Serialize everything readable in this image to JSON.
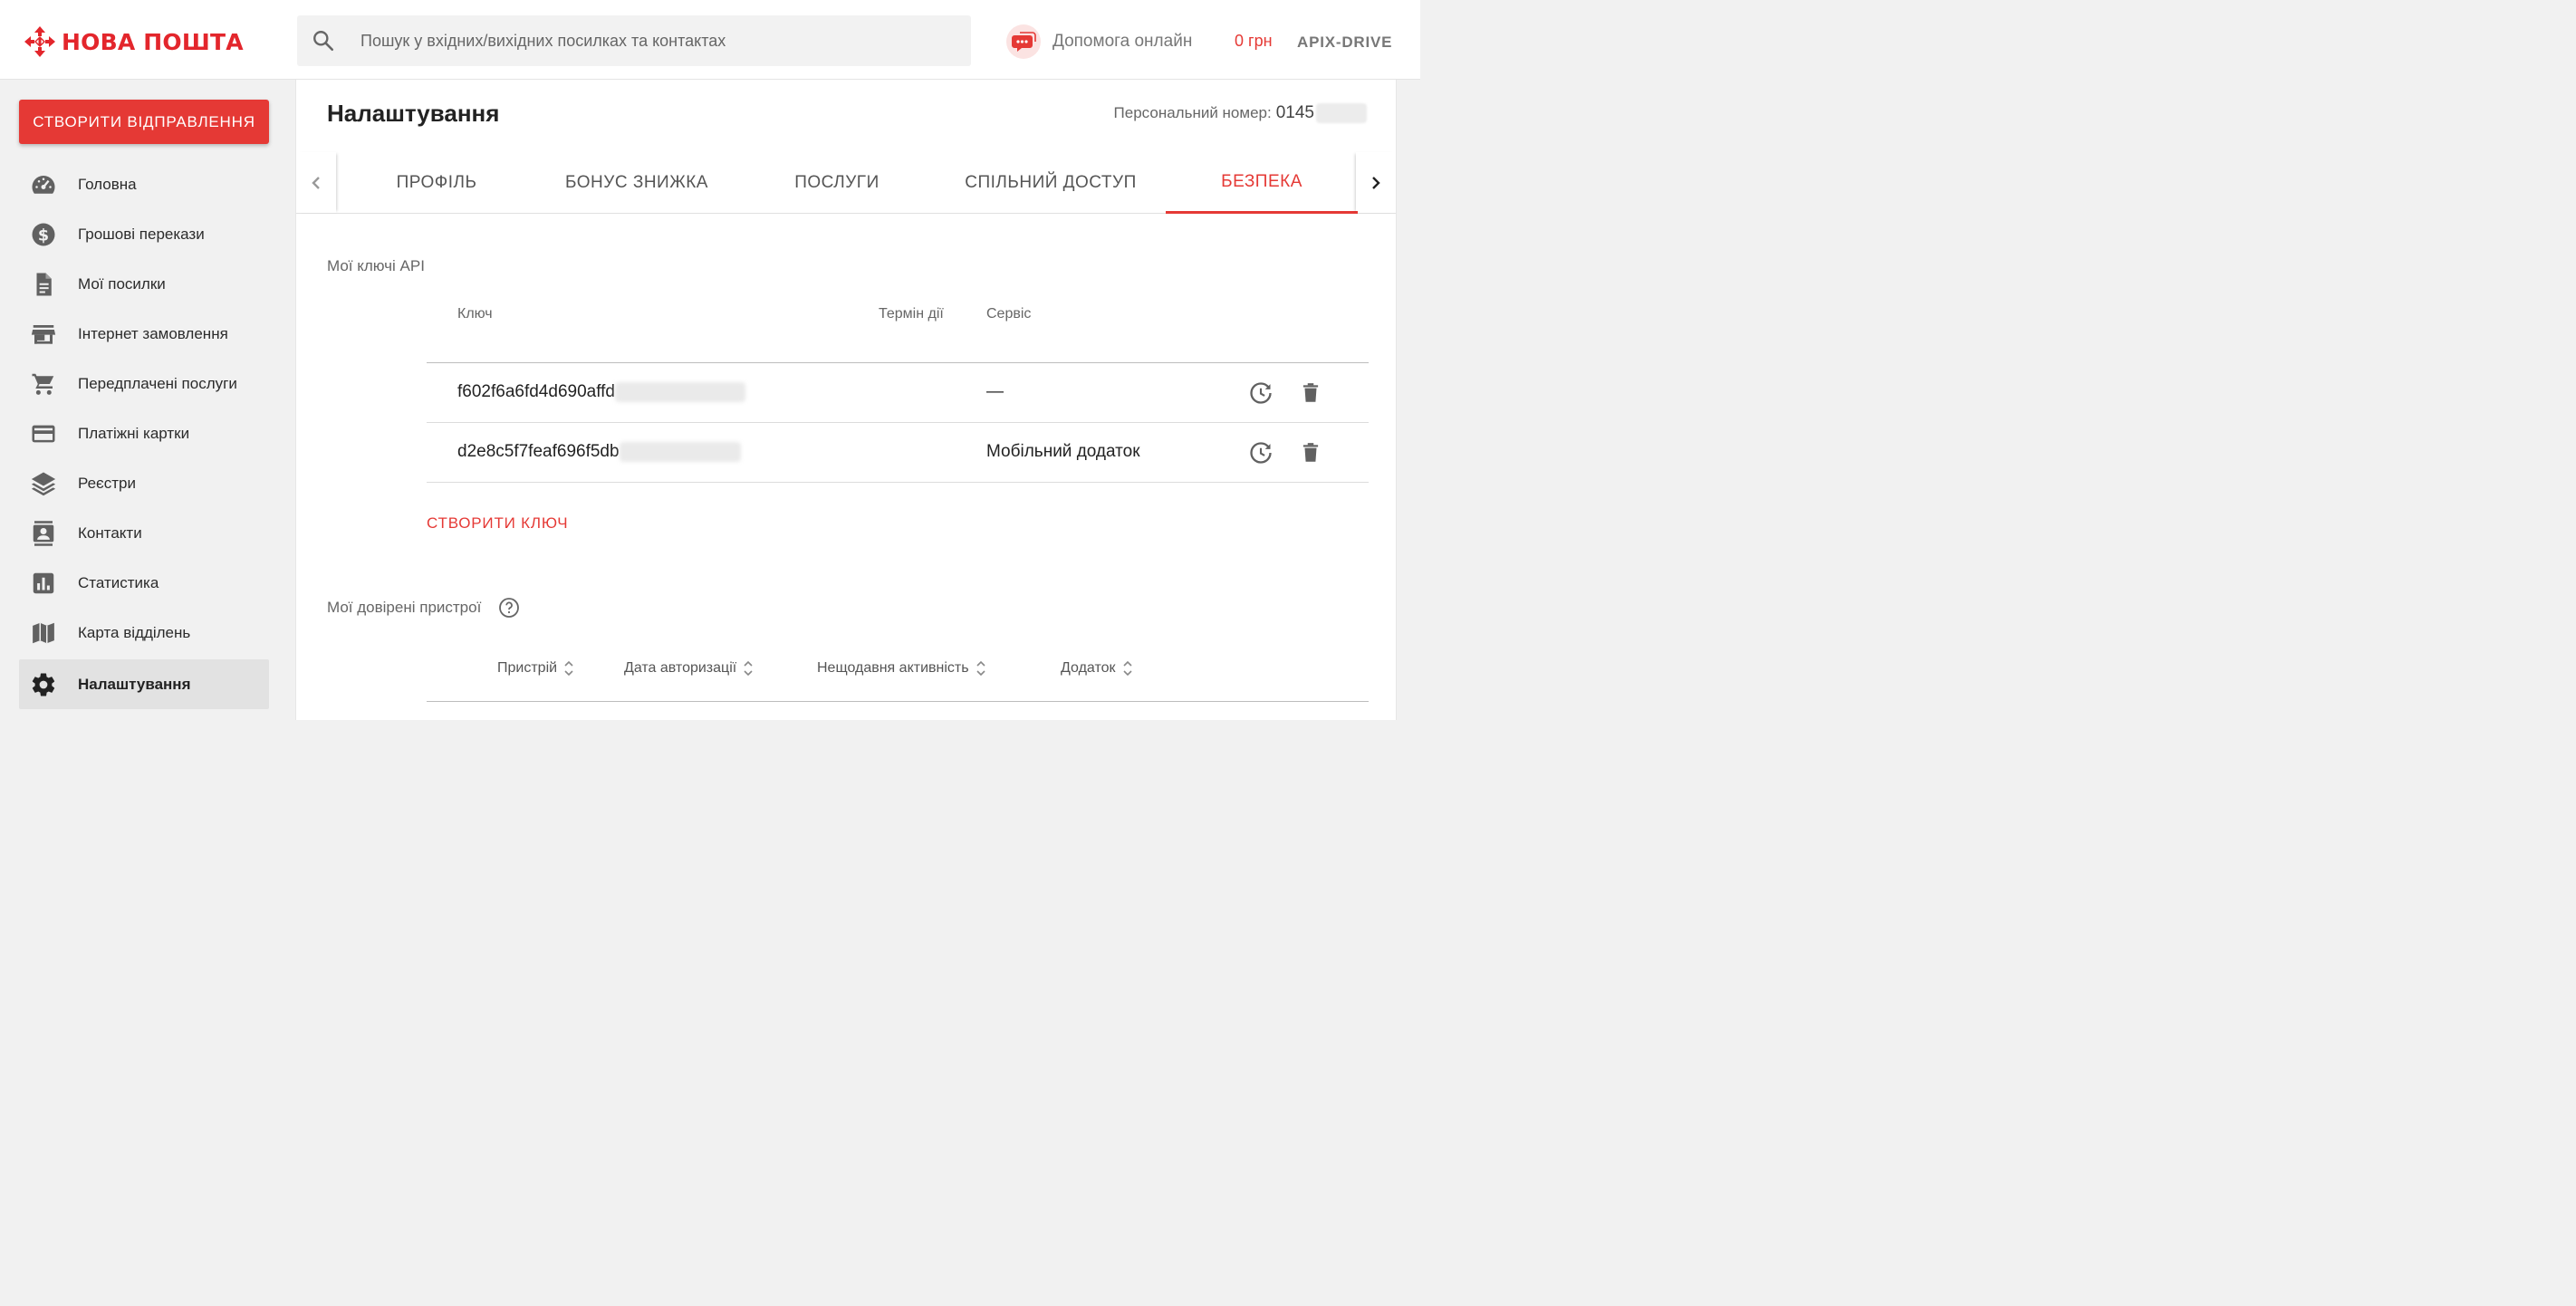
{
  "header": {
    "logo_text": "НОВА ПОШТА",
    "search_placeholder": "Пошук у вхідних/вихідних посилках та контактах",
    "help_label": "Допомога онлайн",
    "balance": "0 грн",
    "username": "APIX-DRIVE"
  },
  "sidebar": {
    "create_button": "СТВОРИТИ ВІДПРАВЛЕННЯ",
    "items": [
      {
        "label": "Головна",
        "icon": "speedometer-icon"
      },
      {
        "label": "Грошові перекази",
        "icon": "dollar-circle-icon"
      },
      {
        "label": "Мої посилки",
        "icon": "document-icon"
      },
      {
        "label": "Інтернет замовлення",
        "icon": "store-icon"
      },
      {
        "label": "Передплачені послуги",
        "icon": "cart-icon"
      },
      {
        "label": "Платіжні картки",
        "icon": "credit-card-icon"
      },
      {
        "label": "Реєстри",
        "icon": "layers-icon"
      },
      {
        "label": "Контакти",
        "icon": "contact-icon"
      },
      {
        "label": "Статистика",
        "icon": "bar-chart-icon"
      },
      {
        "label": "Карта відділень",
        "icon": "map-icon"
      },
      {
        "label": "Налаштування",
        "icon": "gear-icon",
        "active": true
      }
    ]
  },
  "main": {
    "title": "Налаштування",
    "personal_label": "Персональний номер:",
    "personal_value": "0145",
    "tabs": [
      {
        "label": "ПРОФІЛЬ"
      },
      {
        "label": "БОНУС ЗНИЖКА"
      },
      {
        "label": "ПОСЛУГИ"
      },
      {
        "label": "СПІЛЬНИЙ ДОСТУП"
      },
      {
        "label": "БЕЗПЕКА",
        "active": true
      }
    ],
    "api_section": {
      "title": "Мої ключі API",
      "headers": {
        "key": "Ключ",
        "term": "Термін дії",
        "service": "Сервіс"
      },
      "rows": [
        {
          "key": "f602f6a6fd4d690affd",
          "term": "",
          "service": "—"
        },
        {
          "key": "d2e8c5f7feaf696f5db",
          "term": "",
          "service": "Мобільний додаток"
        }
      ],
      "create_label": "СТВОРИТИ КЛЮЧ"
    },
    "devices_section": {
      "title": "Мої довірені пристрої",
      "headers": [
        "Пристрій",
        "Дата авторизації",
        "Нещодавня активність",
        "Додаток"
      ]
    }
  },
  "colors": {
    "accent": "#e53935",
    "logo": "#e3262c",
    "icon": "#616161"
  }
}
